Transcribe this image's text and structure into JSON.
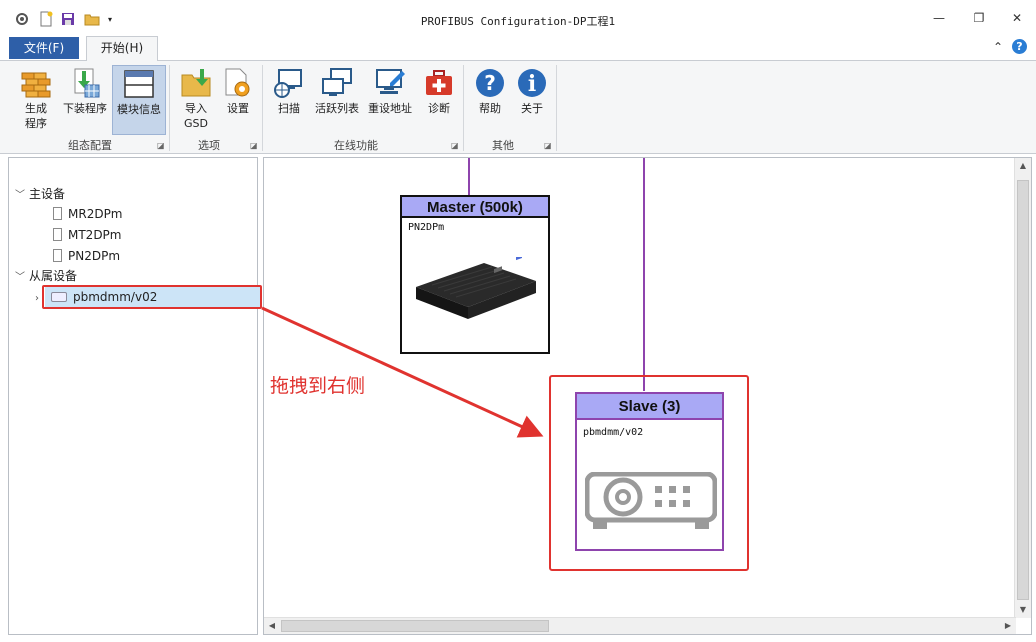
{
  "window": {
    "title": "PROFIBUS Configuration-DP工程1",
    "minimize": "—",
    "restore": "❐",
    "close": "✕"
  },
  "tabs": {
    "file": "文件(F)",
    "home": "开始(H)"
  },
  "ribbon": {
    "groups": [
      {
        "label": "组态配置",
        "buttons": [
          {
            "label": "生成",
            "label2": "程序",
            "icon": "build-icon"
          },
          {
            "label": "下装程序",
            "icon": "download-icon"
          },
          {
            "label": "模块信息",
            "icon": "module-info-icon"
          }
        ]
      },
      {
        "label": "选项",
        "buttons": [
          {
            "label": "导入",
            "label2": "GSD",
            "icon": "import-folder-icon"
          },
          {
            "label": "设置",
            "icon": "settings-icon"
          }
        ]
      },
      {
        "label": "在线功能",
        "buttons": [
          {
            "label": "扫描",
            "icon": "scan-icon"
          },
          {
            "label": "活跃列表",
            "icon": "active-list-icon"
          },
          {
            "label": "重设地址",
            "icon": "reset-address-icon"
          },
          {
            "label": "诊断",
            "icon": "diagnose-icon"
          }
        ]
      },
      {
        "label": "其他",
        "buttons": [
          {
            "label": "帮助",
            "icon": "help-icon"
          },
          {
            "label": "关于",
            "icon": "info-icon"
          }
        ]
      }
    ]
  },
  "tree": {
    "masters_label": "主设备",
    "masters": [
      "MR2DPm",
      "MT2DPm",
      "PN2DPm"
    ],
    "slaves_label": "从属设备",
    "slaves": [
      "pbmdmm/v02"
    ]
  },
  "canvas": {
    "master": {
      "title": "Master (500k)",
      "device": "PN2DPm"
    },
    "slave": {
      "title": "Slave (3)",
      "device": "pbmdmm/v02"
    },
    "annotation": "拖拽到右侧"
  },
  "colors": {
    "accent": "#2e5fa8",
    "bus": "#8e44ad",
    "node_header": "#a9a9f5",
    "highlight": "#e0332f"
  }
}
